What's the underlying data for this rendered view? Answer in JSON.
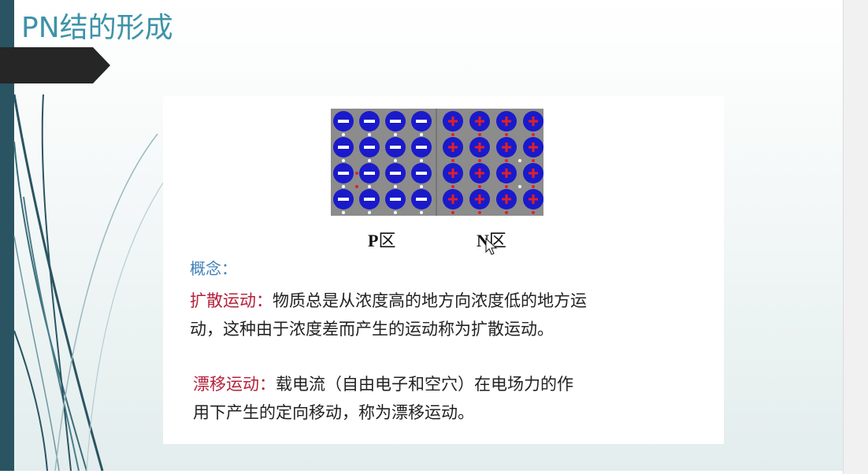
{
  "slide": {
    "title": "PN结的形成",
    "colors": {
      "title": "#3d93a8",
      "left_bar": "#2a5462",
      "banner": "#262626",
      "term": "#b5203a",
      "concept": "#3d7fb6"
    }
  },
  "diagram": {
    "p_region": {
      "label_bold": "P",
      "label_cjk": "区",
      "ion_sign": "−",
      "ion_rows": 4,
      "ion_cols": 4
    },
    "n_region": {
      "label_bold": "N",
      "label_cjk": "区",
      "ion_sign": "+",
      "ion_rows": 4,
      "ion_cols": 4
    }
  },
  "content": {
    "concept_heading": "概念：",
    "diffusion_term": "扩散运动：",
    "diffusion_line1": "物质总是从浓度高的地方向浓度低的地方运",
    "diffusion_line2": "动，这种由于浓度差而产生的运动称为扩散运动。",
    "drift_term": "漂移运动：",
    "drift_line1": "载电流（自由电子和空穴）在电场力的作",
    "drift_line2": "用下产生的定向移动，称为漂移运动。"
  }
}
